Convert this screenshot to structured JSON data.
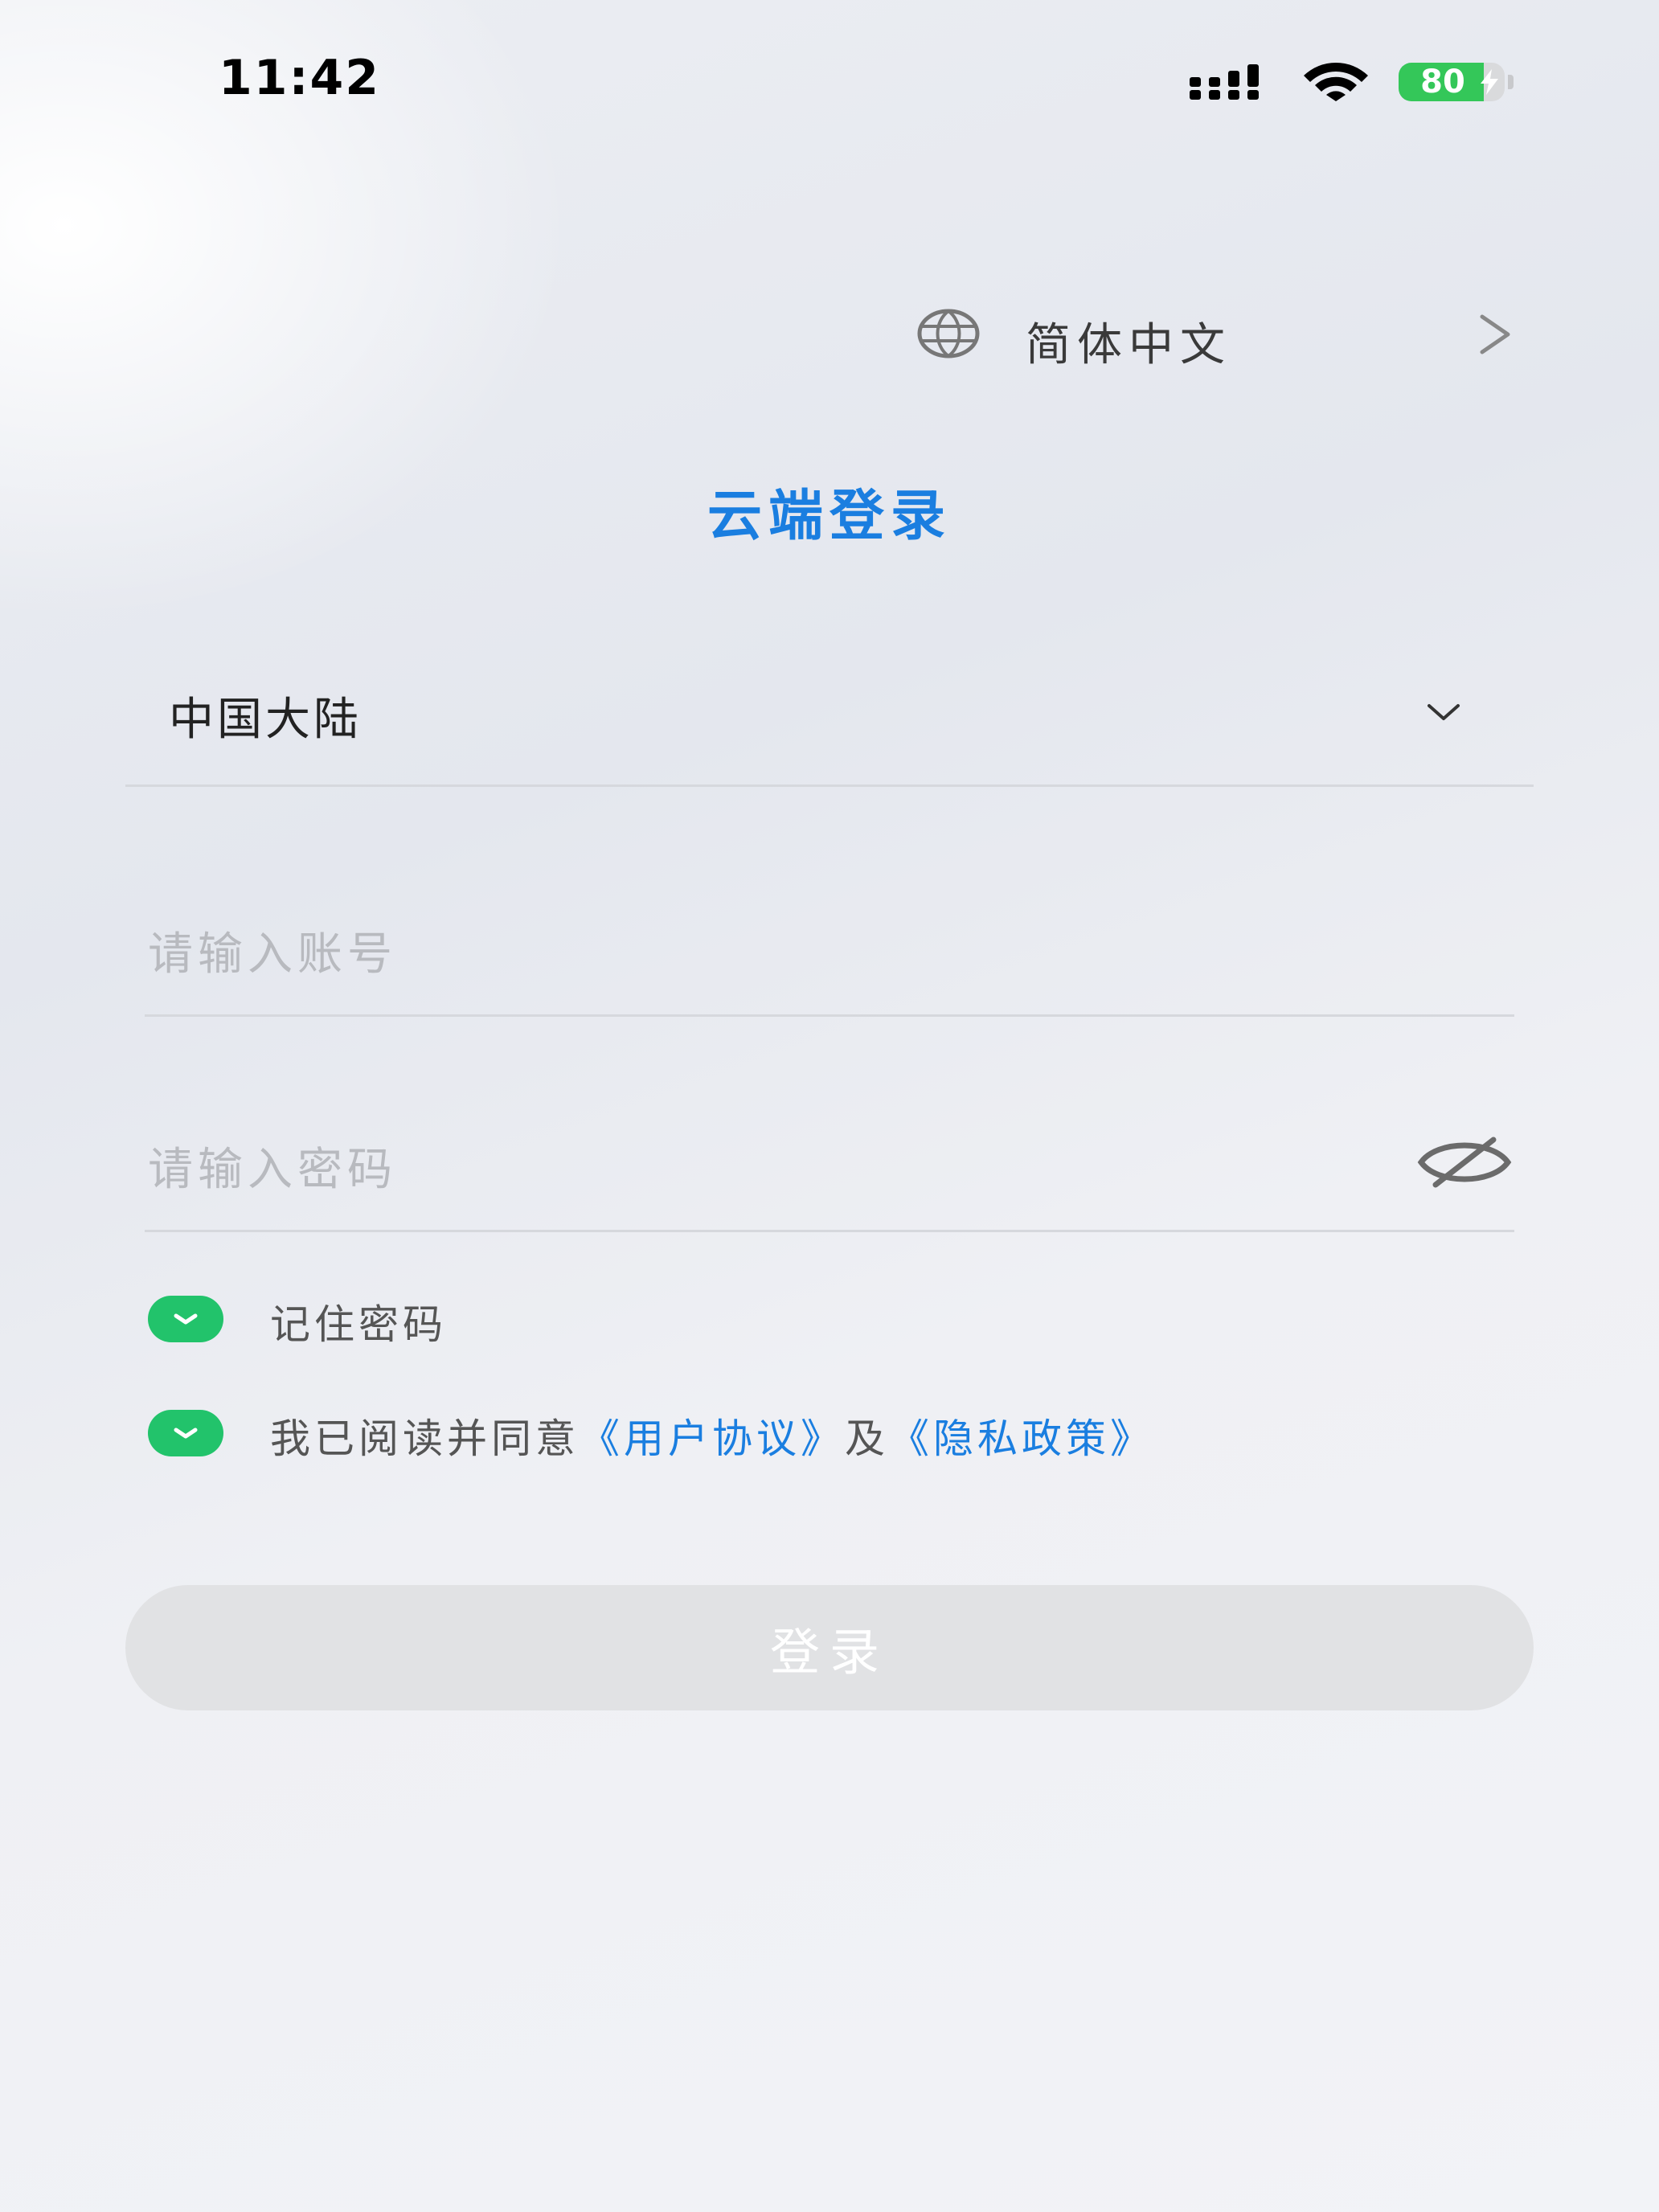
{
  "status_bar": {
    "time": "11:42",
    "battery_level": 80,
    "battery_text": "80",
    "battery_color": "#34c759"
  },
  "language": {
    "label": "简体中文",
    "icon": "globe-icon"
  },
  "title": "云端登录",
  "region": {
    "value": "中国大陆"
  },
  "account": {
    "value": "",
    "placeholder": "请输入账号"
  },
  "password": {
    "value": "",
    "placeholder": "请输入密码",
    "visibility_icon": "eye-off-icon"
  },
  "remember": {
    "checked": true,
    "label": "记住密码"
  },
  "agreement": {
    "checked": true,
    "prefix": "我已阅读并同意",
    "user_agreement": "《用户协议》",
    "conjunction": "及",
    "privacy_policy": "《隐私政策》"
  },
  "login_button": {
    "label": "登录",
    "enabled": false
  },
  "colors": {
    "accent": "#1a7ee0",
    "check_green": "#22c36b",
    "button_disabled": "#e1e2e4"
  }
}
